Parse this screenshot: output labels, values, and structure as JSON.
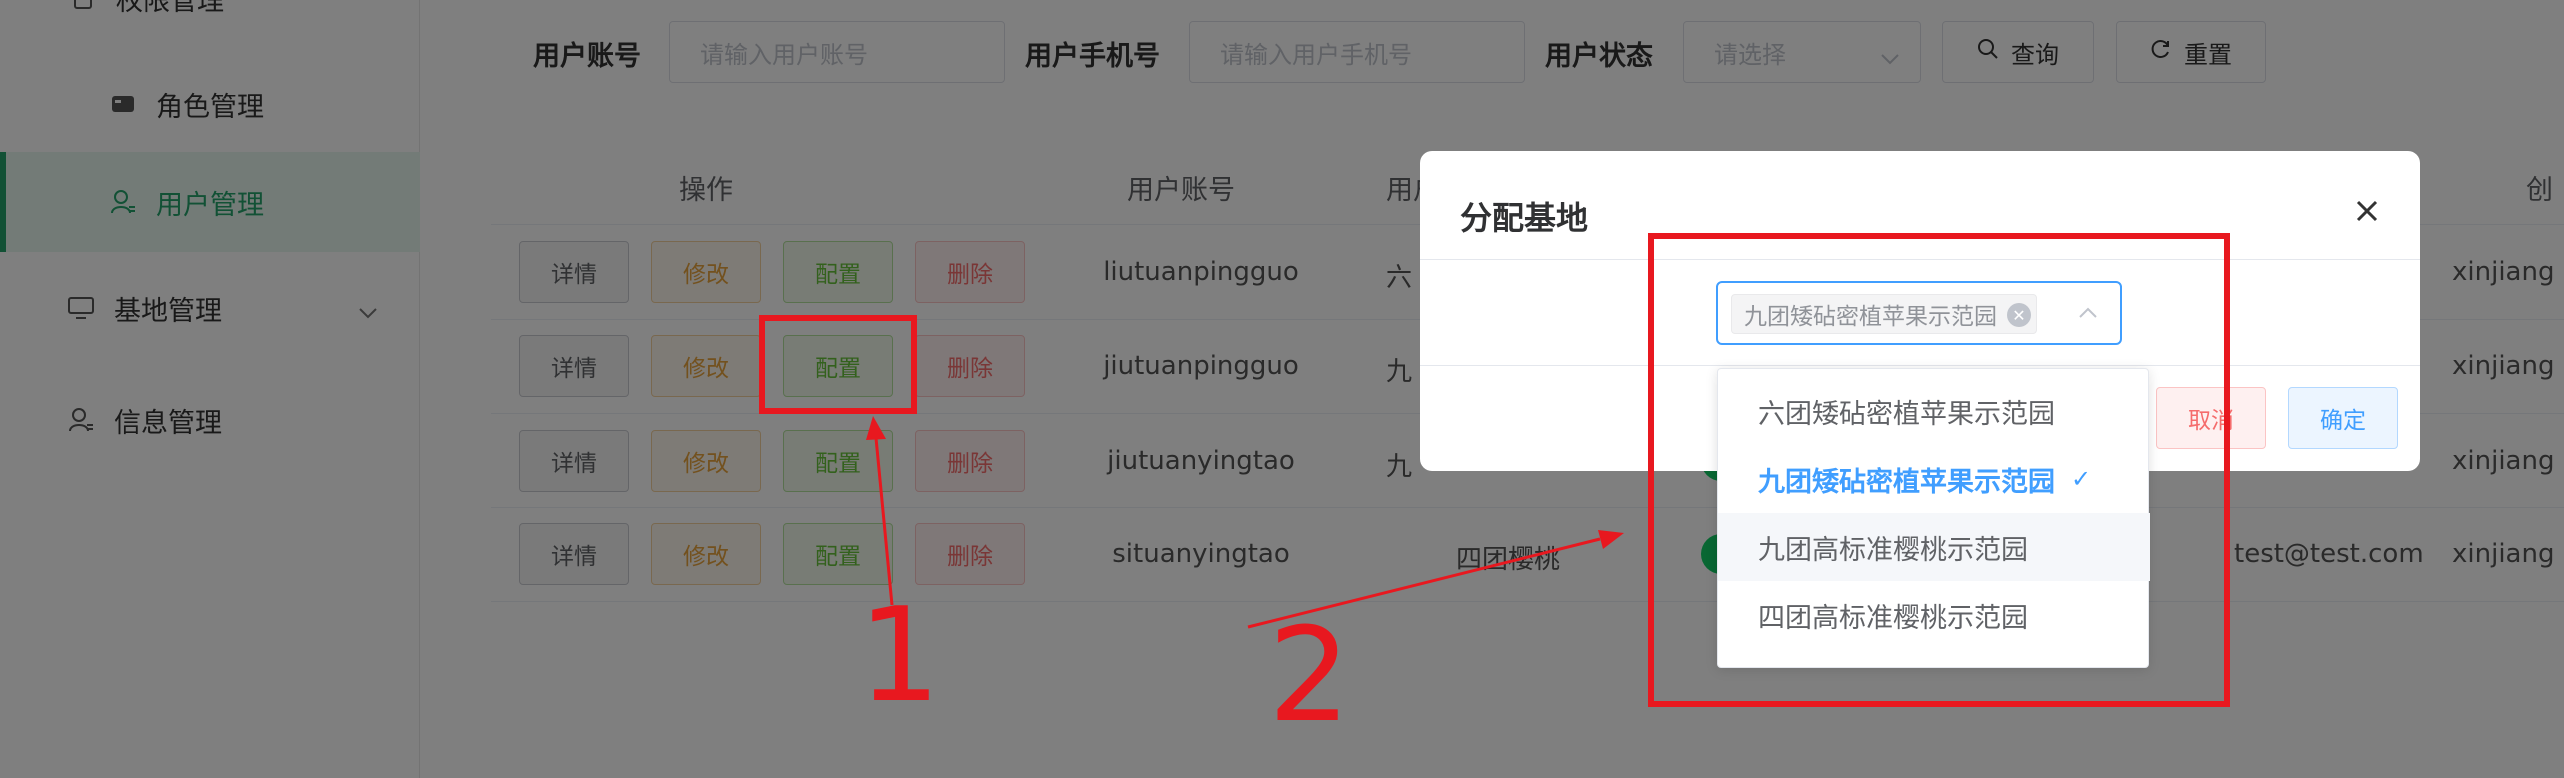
{
  "sidebar": {
    "items": [
      {
        "label": "权限管理",
        "icon": "lock-icon"
      },
      {
        "label": "角色管理",
        "icon": "id-card-icon"
      },
      {
        "label": "用户管理",
        "icon": "user-icon"
      },
      {
        "label": "基地管理",
        "icon": "monitor-icon"
      },
      {
        "label": "信息管理",
        "icon": "user-icon"
      }
    ],
    "accent": "#24a36b"
  },
  "search": {
    "account_label": "用户账号",
    "account_placeholder": "请输入用户账号",
    "phone_label": "用户手机号",
    "phone_placeholder": "请输入用户手机号",
    "status_label": "用户状态",
    "status_placeholder": "请选择",
    "query_label": "查询",
    "reset_label": "重置"
  },
  "table": {
    "headers": [
      "操作",
      "用户账号",
      "用户",
      "创"
    ],
    "actions": {
      "detail": "详情",
      "edit": "修改",
      "config": "配置",
      "delete": "删除"
    },
    "rows": [
      {
        "account": "liutuanpingguo",
        "name": "六",
        "email": "",
        "creator": "xinjiang"
      },
      {
        "account": "jiutuanpingguo",
        "name": "九",
        "email": "",
        "creator": "xinjiang"
      },
      {
        "account": "jiutuanyingtao",
        "name": "九",
        "email": "",
        "creator": "xinjiang"
      },
      {
        "account": "situanyingtao",
        "name": "四团樱桃",
        "email": "test@test.com",
        "creator": "xinjiang"
      }
    ]
  },
  "dialog": {
    "title": "分配基地",
    "selected_tag": "九团矮砧密植苹果示范园",
    "cancel_label": "取消",
    "ok_label": "确定",
    "options": [
      {
        "label": "六团矮砧密植苹果示范园",
        "selected": false
      },
      {
        "label": "九团矮砧密植苹果示范园",
        "selected": true
      },
      {
        "label": "九团高标准樱桃示范园",
        "selected": false
      },
      {
        "label": "四团高标准樱桃示范园",
        "selected": false
      }
    ],
    "check_mark": "✓"
  },
  "annotations": {
    "one": "1",
    "two": "2",
    "color": "#e8181f"
  }
}
